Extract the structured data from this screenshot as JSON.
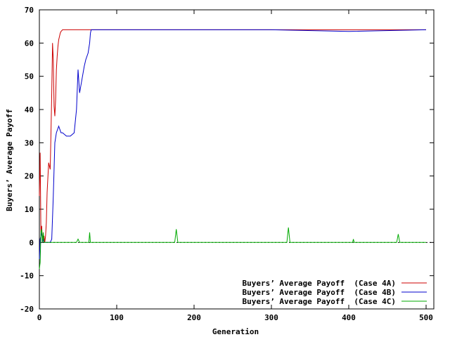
{
  "chart_data": {
    "type": "line",
    "xlabel": "Generation",
    "ylabel": "Buyers’ Average Payoff",
    "xlim": [
      0,
      510
    ],
    "ylim": [
      -20,
      70
    ],
    "xticks": [
      0,
      100,
      200,
      300,
      400,
      500
    ],
    "yticks": [
      -20,
      -10,
      0,
      10,
      20,
      30,
      40,
      50,
      60,
      70
    ],
    "legend_position": "bottom-right",
    "grid": false,
    "series": [
      {
        "name": "Buyers’ Average Payoff  (Case 4A)",
        "color": "#cc0000",
        "x": [
          0,
          1,
          2,
          3,
          4,
          5,
          6,
          7,
          8,
          9,
          10,
          12,
          14,
          15,
          16,
          17,
          18,
          19,
          20,
          21,
          22,
          23,
          24,
          25,
          26,
          27,
          28,
          30,
          35,
          40,
          60,
          100,
          200,
          300,
          400,
          500
        ],
        "y": [
          14,
          27,
          3,
          5,
          0,
          1,
          2,
          0,
          2,
          6,
          15,
          24,
          22,
          33,
          45,
          60,
          55,
          41,
          38,
          43,
          52,
          56,
          59,
          61,
          62,
          63,
          63.5,
          64,
          64,
          64,
          64,
          64,
          64,
          64,
          64,
          64
        ]
      },
      {
        "name": "Buyers’ Average Payoff  (Case 4B)",
        "color": "#0000cc",
        "x": [
          0,
          1,
          2,
          3,
          4,
          5,
          6,
          8,
          10,
          12,
          14,
          16,
          18,
          20,
          22,
          25,
          28,
          30,
          35,
          40,
          45,
          48,
          50,
          52,
          55,
          58,
          60,
          63,
          65,
          66,
          67,
          70,
          100,
          200,
          300,
          400,
          500
        ],
        "y": [
          -5,
          1,
          2,
          3,
          0,
          1,
          0,
          0,
          0,
          0,
          0,
          1,
          14,
          30,
          33,
          35,
          33,
          33,
          32,
          32,
          33,
          40,
          52,
          45,
          49,
          53,
          55,
          57,
          60,
          63,
          64,
          64,
          64,
          64,
          64,
          63.5,
          64
        ]
      },
      {
        "name": "Buyers’ Average Payoff  (Case 4C)",
        "color": "#00aa00",
        "x": [
          0,
          1,
          2,
          3,
          4,
          5,
          6,
          8,
          10,
          15,
          20,
          30,
          40,
          48,
          50,
          52,
          60,
          64,
          65,
          66,
          70,
          100,
          150,
          175,
          177,
          179,
          200,
          250,
          300,
          320,
          322,
          324,
          350,
          400,
          405,
          406,
          407,
          450,
          462,
          464,
          466,
          500
        ],
        "y": [
          -8,
          -6,
          3,
          4,
          0,
          3,
          0,
          0,
          0,
          0,
          0,
          0,
          0,
          0,
          1,
          0,
          0,
          0,
          3,
          0,
          0,
          0,
          0,
          0,
          4,
          0,
          0,
          0,
          0,
          0,
          4.5,
          0,
          0,
          0,
          0,
          1,
          0,
          0,
          0,
          2.5,
          0,
          0
        ]
      }
    ]
  }
}
